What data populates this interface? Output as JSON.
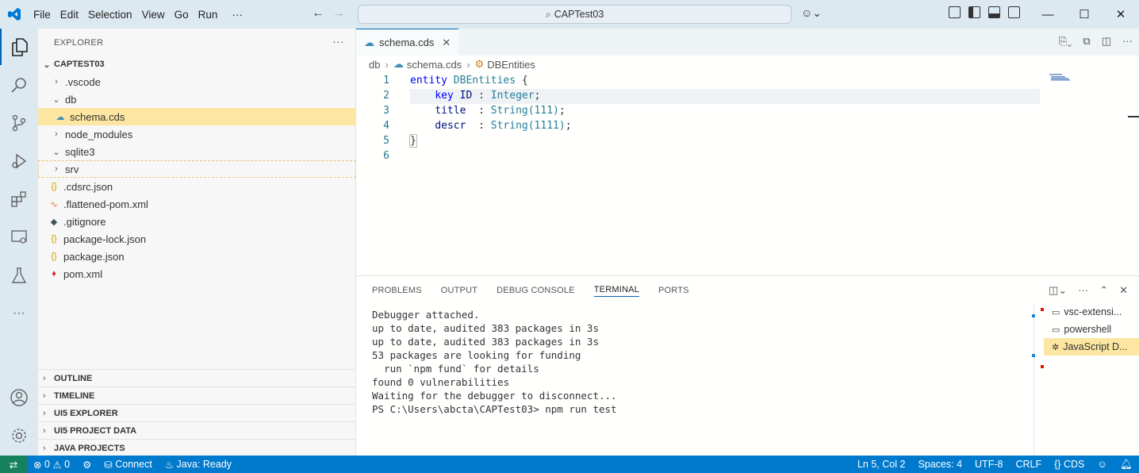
{
  "menu": [
    "File",
    "Edit",
    "Selection",
    "View",
    "Go",
    "Run",
    "···"
  ],
  "search_text": "CAPTest03",
  "explorer": {
    "header": "EXPLORER",
    "root": "CAPTEST03",
    "items": [
      {
        "label": ".vscode",
        "type": "folder",
        "open": false
      },
      {
        "label": "db",
        "type": "folder",
        "open": true
      },
      {
        "label": "schema.cds",
        "type": "cds"
      },
      {
        "label": "node_modules",
        "type": "folder",
        "open": false
      },
      {
        "label": "sqlite3",
        "type": "folder",
        "open": true
      },
      {
        "label": "srv",
        "type": "folder",
        "open": false
      },
      {
        "label": ".cdsrc.json",
        "type": "json"
      },
      {
        "label": ".flattened-pom.xml",
        "type": "xml"
      },
      {
        "label": ".gitignore",
        "type": "git"
      },
      {
        "label": "package-lock.json",
        "type": "json"
      },
      {
        "label": "package.json",
        "type": "json"
      },
      {
        "label": "pom.xml",
        "type": "maven"
      }
    ],
    "sections": [
      "OUTLINE",
      "TIMELINE",
      "UI5 EXPLORER",
      "UI5 PROJECT DATA",
      "JAVA PROJECTS"
    ]
  },
  "editor": {
    "tab_label": "schema.cds",
    "breadcrumb": [
      "db",
      "schema.cds",
      "DBEntities"
    ],
    "line_numbers": [
      "1",
      "2",
      "3",
      "4",
      "5",
      "6"
    ]
  },
  "panel": {
    "tabs": [
      "PROBLEMS",
      "OUTPUT",
      "DEBUG CONSOLE",
      "TERMINAL",
      "PORTS"
    ],
    "terminal_lines": [
      "Debugger attached.",
      "",
      "up to date, audited 383 packages in 3s",
      "",
      "up to date, audited 383 packages in 3s",
      "53 packages are looking for funding",
      "  run `npm fund` for details",
      "",
      "found 0 vulnerabilities",
      "Waiting for the debugger to disconnect...",
      "PS C:\\Users\\abcta\\CAPTest03> npm run test"
    ],
    "terminals": [
      {
        "label": "vsc-extensi...",
        "icon": "terminal-icon"
      },
      {
        "label": "powershell",
        "icon": "terminal-icon"
      },
      {
        "label": "JavaScript D...",
        "icon": "debug-icon"
      }
    ]
  },
  "status": {
    "errors": "0",
    "warnings": "0",
    "connect": "Connect",
    "java": "Java: Ready",
    "position": "Ln 5, Col 2",
    "spaces": "Spaces: 4",
    "encoding": "UTF-8",
    "eol": "CRLF",
    "language": "CDS"
  },
  "colors": {
    "accent": "#007acc",
    "selection": "#fce6a1",
    "remote": "#16825d"
  }
}
